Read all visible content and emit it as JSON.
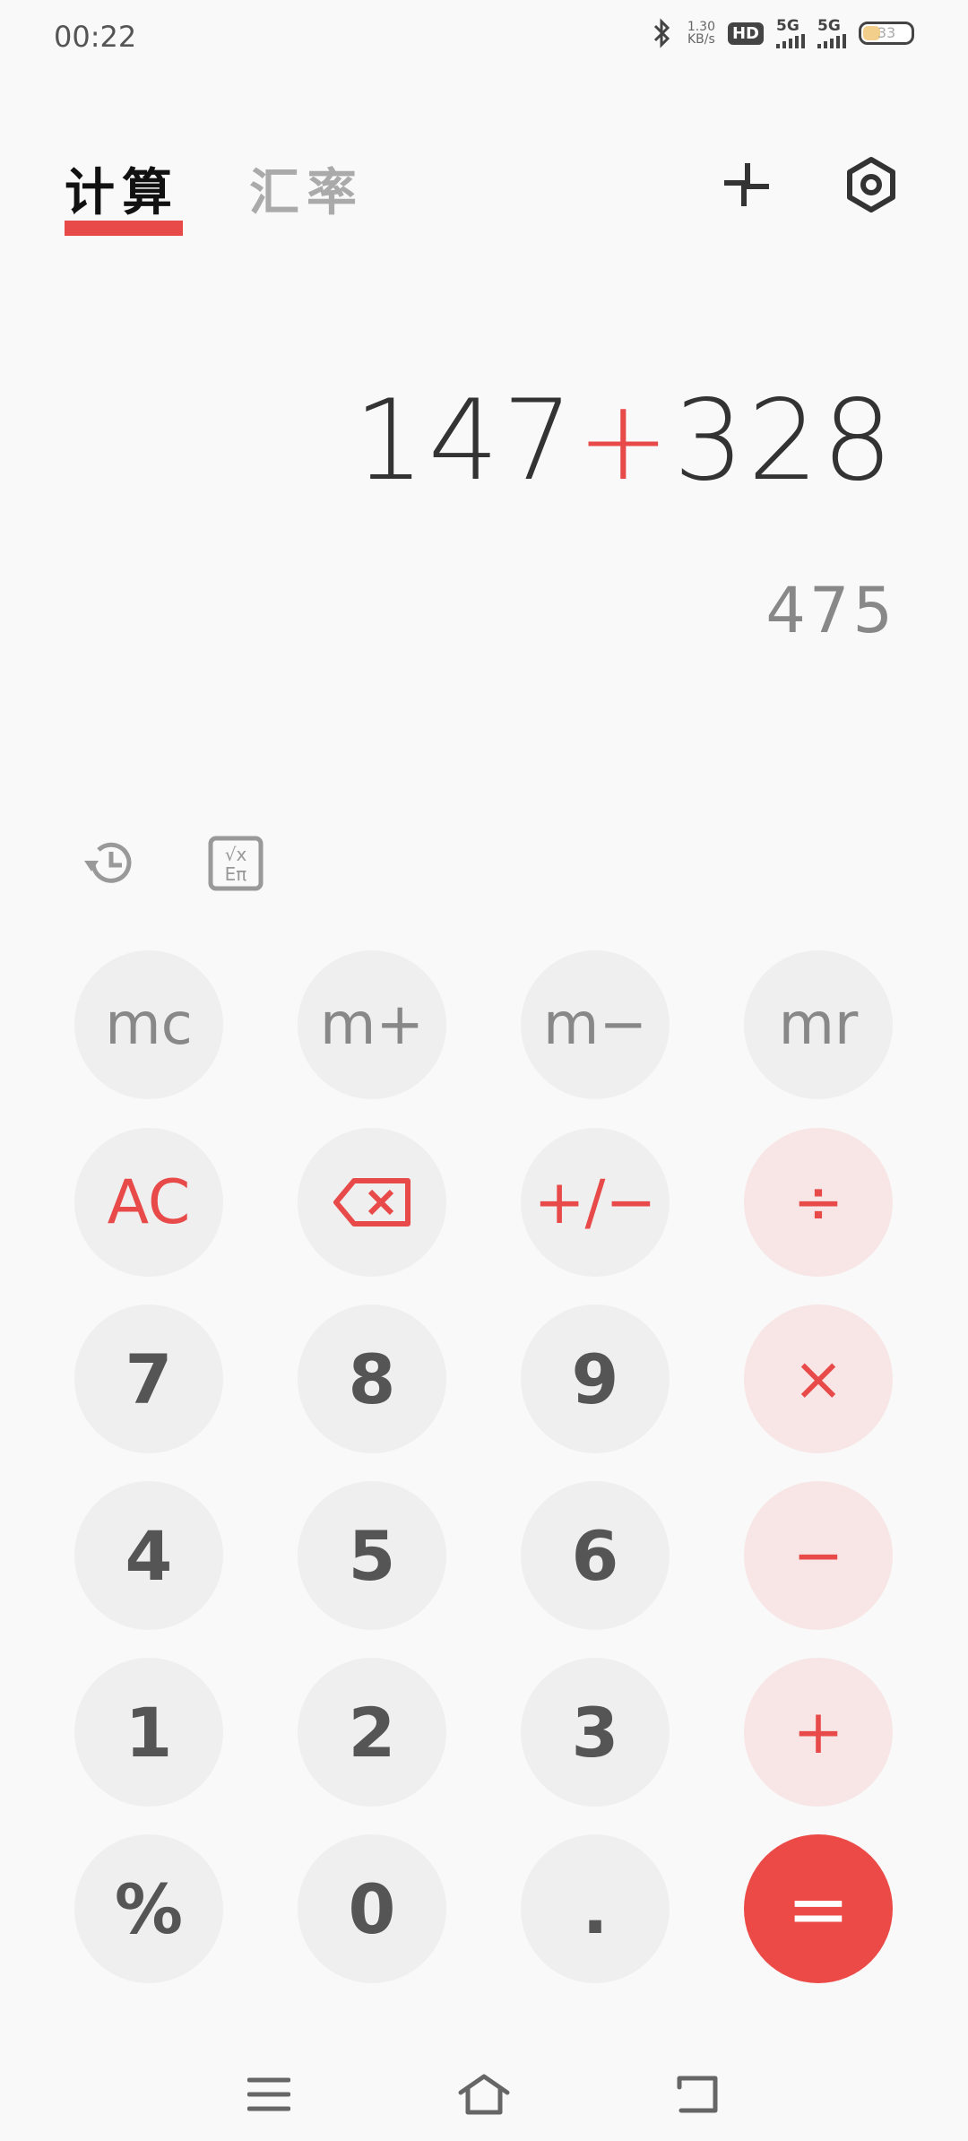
{
  "status": {
    "time": "00:22",
    "speed_value": "1.30",
    "speed_unit": "KB/s",
    "hd": "HD",
    "sim1": "5G",
    "sim2": "5G",
    "battery": "33"
  },
  "tabs": [
    {
      "label": "计算"
    },
    {
      "label": "汇率"
    }
  ],
  "display": {
    "operand1": "147",
    "operator": "+",
    "operand2": "328",
    "result": "475"
  },
  "keys": {
    "mc": "mc",
    "mplus": "m+",
    "mminus": "m−",
    "mr": "mr",
    "ac": "AC",
    "plusminus": "+/−",
    "divide": "÷",
    "seven": "7",
    "eight": "8",
    "nine": "9",
    "multiply": "×",
    "four": "4",
    "five": "5",
    "six": "6",
    "minus": "−",
    "one": "1",
    "two": "2",
    "three": "3",
    "plus": "+",
    "percent": "%",
    "zero": "0",
    "dot": ".",
    "equals": "="
  },
  "colors": {
    "accent": "#e84a4a",
    "key_bg": "#efefef",
    "op_bg": "#f8e6e6"
  }
}
